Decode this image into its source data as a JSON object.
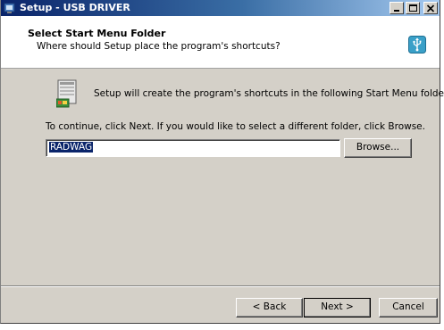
{
  "window": {
    "title": "Setup - USB DRIVER",
    "icon": "setup-icon",
    "controls": [
      "minimize-icon",
      "maximize-icon",
      "close-icon"
    ]
  },
  "header": {
    "title": "Select Start Menu Folder",
    "subtitle": "Where should Setup place the program's shortcuts?",
    "icon": "usb-icon"
  },
  "body": {
    "icon": "start-menu-folder-icon",
    "line1": "Setup will create the program's shortcuts in the following Start Menu folder.",
    "line2": "To continue, click Next. If you would like to select a different folder, click Browse.",
    "folder_value": "RADWAG",
    "browse_label": "Browse..."
  },
  "footer": {
    "back_label": "< Back",
    "next_label": "Next >",
    "cancel_label": "Cancel"
  },
  "colors": {
    "titlebar_start": "#0a246a",
    "titlebar_end": "#a6caf0",
    "dialog_bg": "#d4d0c8",
    "selection": "#0a246a"
  }
}
